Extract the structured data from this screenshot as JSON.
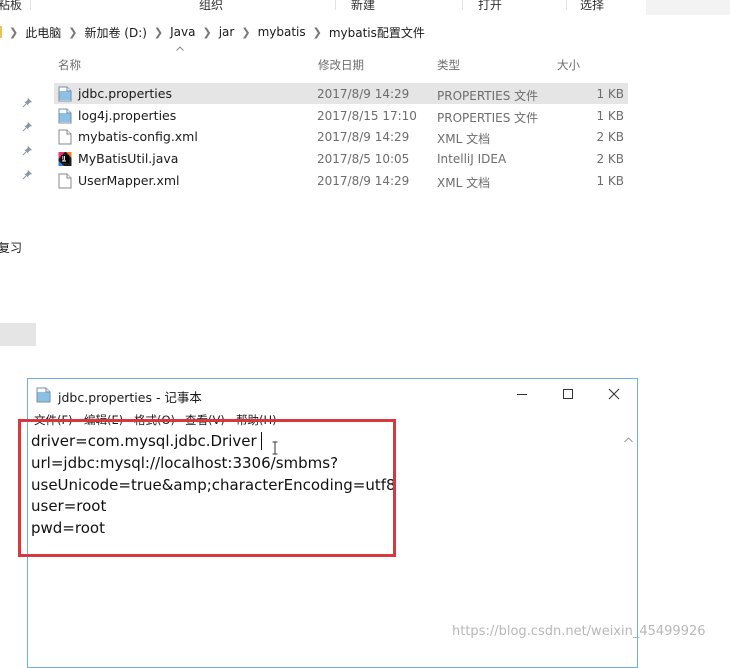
{
  "ribbon": {
    "items": [
      "粘板",
      "组织",
      "新建",
      "打开",
      "选择"
    ]
  },
  "breadcrumb": {
    "items": [
      "此电脑",
      "新加卷 (D:)",
      "Java",
      "jar",
      "mybatis",
      "mybatis配置文件"
    ]
  },
  "columns": {
    "name": "名称",
    "date": "修改日期",
    "type": "类型",
    "size": "大小"
  },
  "files": [
    {
      "name": "jdbc.properties",
      "date": "2017/8/9 14:29",
      "type": "PROPERTIES 文件",
      "size": "1 KB",
      "icon": "properties-file-icon"
    },
    {
      "name": "log4j.properties",
      "date": "2017/8/15 17:10",
      "type": "PROPERTIES 文件",
      "size": "1 KB",
      "icon": "properties-file-icon"
    },
    {
      "name": "mybatis-config.xml",
      "date": "2017/8/9 14:29",
      "type": "XML 文档",
      "size": "2 KB",
      "icon": "xml-file-icon"
    },
    {
      "name": "MyBatisUtil.java",
      "date": "2017/8/5 10:05",
      "type": "IntelliJ IDEA",
      "size": "2 KB",
      "icon": "intellij-file-icon"
    },
    {
      "name": "UserMapper.xml",
      "date": "2017/8/9 14:29",
      "type": "XML 文档",
      "size": "1 KB",
      "icon": "xml-file-icon"
    }
  ],
  "sidebar": {
    "partial_label": "复习"
  },
  "notepad": {
    "title": "jdbc.properties - 记事本",
    "menus": [
      "文件(F)",
      "编辑(E)",
      "格式(O)",
      "查看(V)",
      "帮助(H)"
    ],
    "lines": [
      "driver=com.mysql.jdbc.Driver",
      "url=jdbc:mysql://localhost:3306/smbms?",
      "useUnicode=true&amp;characterEncoding=utf8",
      "user=root",
      "pwd=root"
    ]
  },
  "watermark": "https://blog.csdn.net/weixin_45499926",
  "colors": {
    "selected_row": "#e5e5e5",
    "annotation_red": "#d9363e",
    "window_border": "#6bb1e6"
  }
}
